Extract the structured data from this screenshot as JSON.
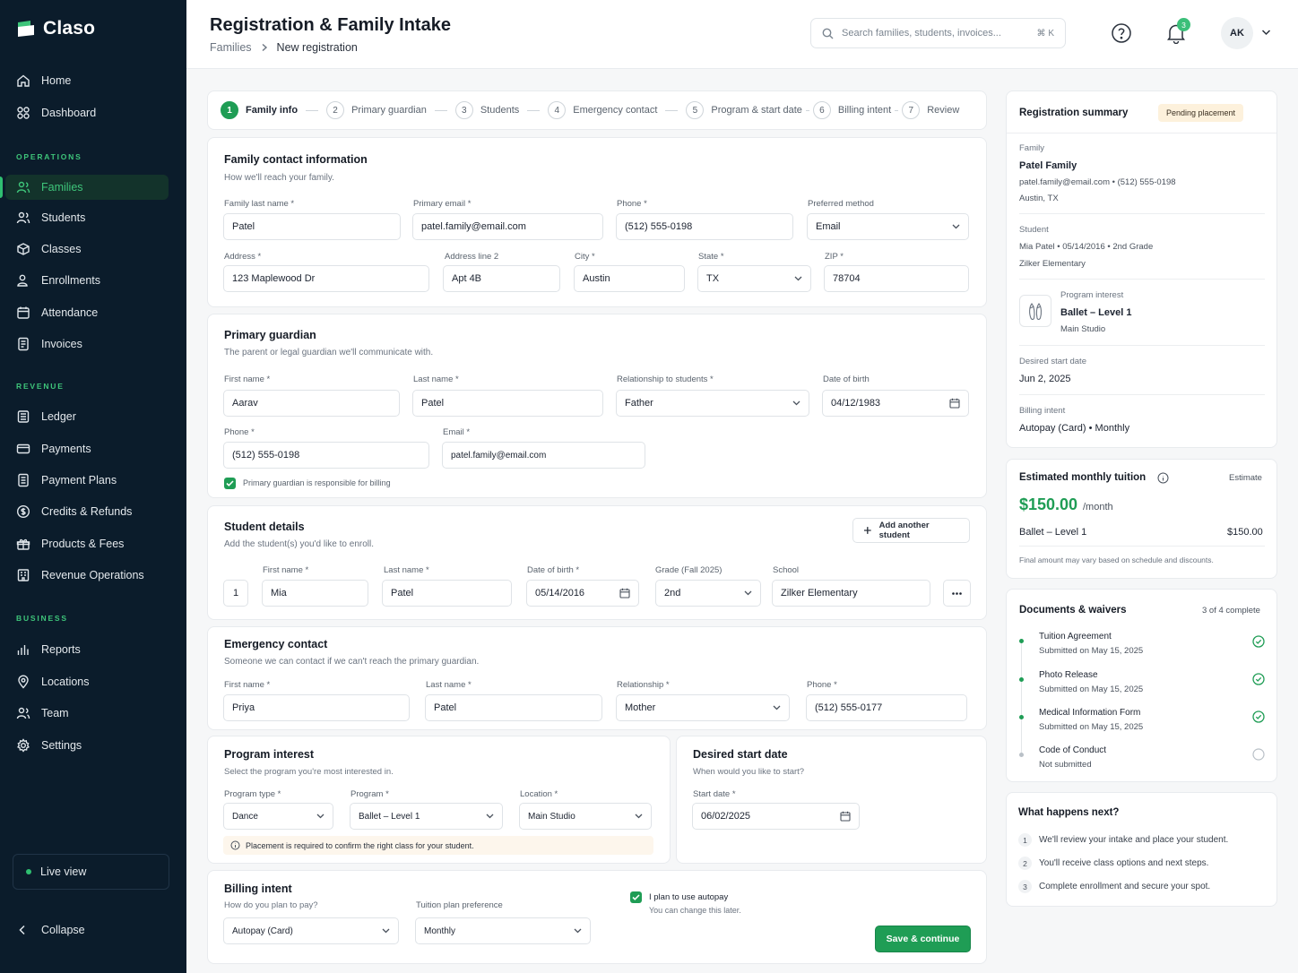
{
  "app": {
    "name": "Claso"
  },
  "sidebar": {
    "main": [
      {
        "label": "Home",
        "icon": "home-icon"
      },
      {
        "label": "Dashboard",
        "icon": "dashboard-icon"
      }
    ],
    "operations_title": "OPERATIONS",
    "operations": [
      {
        "label": "Families",
        "icon": "families-icon",
        "active": true
      },
      {
        "label": "Students",
        "icon": "students-icon"
      },
      {
        "label": "Classes",
        "icon": "classes-icon"
      },
      {
        "label": "Enrollments",
        "icon": "enrollments-icon"
      },
      {
        "label": "Attendance",
        "icon": "calendar-icon"
      },
      {
        "label": "Invoices",
        "icon": "invoice-icon"
      }
    ],
    "revenue_title": "REVENUE",
    "revenue": [
      {
        "label": "Ledger",
        "icon": "ledger-icon"
      },
      {
        "label": "Payments",
        "icon": "card-icon"
      },
      {
        "label": "Payment Plans",
        "icon": "plan-icon"
      },
      {
        "label": "Credits & Refunds",
        "icon": "dollar-icon"
      },
      {
        "label": "Products & Fees",
        "icon": "gift-icon"
      },
      {
        "label": "Revenue Operations",
        "icon": "building-icon"
      }
    ],
    "business_title": "BUSINESS",
    "business": [
      {
        "label": "Reports",
        "icon": "chart-icon"
      },
      {
        "label": "Locations",
        "icon": "pin-icon"
      },
      {
        "label": "Team",
        "icon": "team-icon"
      },
      {
        "label": "Settings",
        "icon": "gear-icon"
      }
    ],
    "live_view": "Live view",
    "collapse": "Collapse"
  },
  "header": {
    "title": "Registration & Family Intake",
    "breadcrumb": [
      "Families",
      "New registration"
    ],
    "search_placeholder": "Search families, students, invoices...",
    "search_shortcut": "⌘ K",
    "notifications_count": "3",
    "user_initials": "AK"
  },
  "steps": [
    {
      "num": "1",
      "label": "Family info",
      "active": true
    },
    {
      "num": "2",
      "label": "Primary guardian"
    },
    {
      "num": "3",
      "label": "Students"
    },
    {
      "num": "4",
      "label": "Emergency contact"
    },
    {
      "num": "5",
      "label": "Program & start date"
    },
    {
      "num": "6",
      "label": "Billing intent"
    },
    {
      "num": "7",
      "label": "Review"
    }
  ],
  "family": {
    "title": "Family contact information",
    "subtitle": "How we'll reach your family.",
    "last_name_label": "Family last name *",
    "last_name": "Patel",
    "email_label": "Primary email *",
    "email": "patel.family@email.com",
    "phone_label": "Phone *",
    "phone": "(512) 555-0198",
    "method_label": "Preferred method",
    "method": "Email",
    "address_label": "Address *",
    "address": "123 Maplewood Dr",
    "address2_label": "Address line 2",
    "address2": "Apt 4B",
    "city_label": "City *",
    "city": "Austin",
    "state_label": "State *",
    "state": "TX",
    "zip_label": "ZIP *",
    "zip": "78704"
  },
  "guardian": {
    "title": "Primary guardian",
    "subtitle": "The parent or legal guardian we'll communicate with.",
    "first_label": "First name *",
    "first": "Aarav",
    "last_label": "Last name *",
    "last": "Patel",
    "relationship_label": "Relationship to students *",
    "relationship": "Father",
    "dob_label": "Date of birth",
    "dob": "04/12/1983",
    "phone_label": "Phone *",
    "phone": "(512) 555-0198",
    "email_label": "Email *",
    "email": "patel.family@email.com",
    "billing_check": "Primary guardian is responsible for billing"
  },
  "student": {
    "title": "Student details",
    "subtitle": "Add the student(s) you'd like to enroll.",
    "add_button": "Add another student",
    "index": "1",
    "first_label": "First name *",
    "first": "Mia",
    "last_label": "Last name *",
    "last": "Patel",
    "dob_label": "Date of birth *",
    "dob": "05/14/2016",
    "grade_label": "Grade (Fall 2025)",
    "grade": "2nd",
    "school_label": "School",
    "school": "Zilker Elementary"
  },
  "emergency": {
    "title": "Emergency contact",
    "subtitle": "Someone we can contact if we can't reach the primary guardian.",
    "first_label": "First name *",
    "first": "Priya",
    "last_label": "Last name *",
    "last": "Patel",
    "relationship_label": "Relationship *",
    "relationship": "Mother",
    "phone_label": "Phone *",
    "phone": "(512) 555-0177"
  },
  "program": {
    "title": "Program interest",
    "subtitle": "Select the program you're most interested in.",
    "type_label": "Program type *",
    "type": "Dance",
    "program_label": "Program *",
    "program": "Ballet – Level 1",
    "location_label": "Location *",
    "location": "Main Studio",
    "notice": "Placement is required to confirm the right class for your student."
  },
  "start": {
    "title": "Desired start date",
    "subtitle": "When would you like to start?",
    "date_label": "Start date *",
    "date": "06/02/2025"
  },
  "billing": {
    "title": "Billing intent",
    "subtitle": "How do you plan to pay?",
    "method": "Autopay (Card)",
    "plan_label": "Tuition plan preference",
    "plan": "Monthly",
    "autopay_label": "I plan to use autopay",
    "autopay_note": "You can change this later.",
    "save_button": "Save & continue"
  },
  "summary": {
    "title": "Registration summary",
    "status": "Pending placement",
    "family_label": "Family",
    "family_name": "Patel Family",
    "family_contact": "patel.family@email.com  •  (512) 555-0198",
    "family_location": "Austin, TX",
    "student_label": "Student",
    "student_info": "Mia Patel  •  05/14/2016  •  2nd Grade",
    "student_school": "Zilker Elementary",
    "program_label": "Program interest",
    "program_name": "Ballet – Level 1",
    "program_location": "Main Studio",
    "start_label": "Desired start date",
    "start_date": "Jun 2, 2025",
    "billing_label": "Billing intent",
    "billing_value": "Autopay (Card)  •  Monthly"
  },
  "tuition": {
    "title": "Estimated monthly tuition",
    "tag": "Estimate",
    "amount": "$150.00",
    "unit": "/month",
    "line_label": "Ballet – Level 1",
    "line_amount": "$150.00",
    "note": "Final amount may vary based on schedule and discounts."
  },
  "documents": {
    "title": "Documents & waivers",
    "progress": "3 of 4 complete",
    "items": [
      {
        "name": "Tuition Agreement",
        "status": "Submitted on May 15, 2025",
        "done": true
      },
      {
        "name": "Photo Release",
        "status": "Submitted on May 15, 2025",
        "done": true
      },
      {
        "name": "Medical Information Form",
        "status": "Submitted on May 15, 2025",
        "done": true
      },
      {
        "name": "Code of Conduct",
        "status": "Not submitted",
        "done": false
      }
    ]
  },
  "next": {
    "title": "What happens next?",
    "items": [
      {
        "num": "1",
        "text": "We'll review your intake and place your student."
      },
      {
        "num": "2",
        "text": "You'll receive class options and next steps."
      },
      {
        "num": "3",
        "text": "Complete enrollment and secure your spot."
      }
    ]
  },
  "colors": {
    "accent": "#1f9d55",
    "sidebar": "#0b1c2b",
    "active_nav": "#3ec57a"
  }
}
